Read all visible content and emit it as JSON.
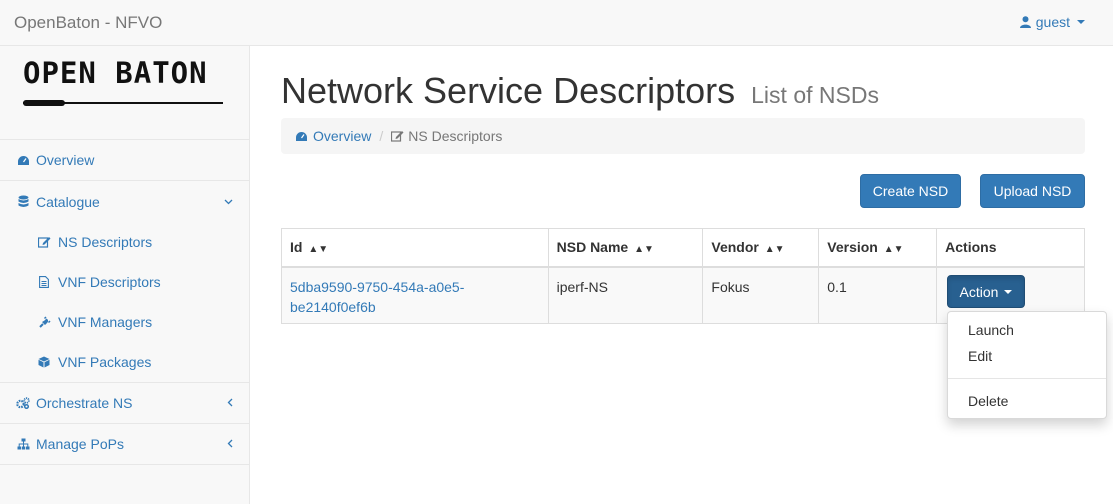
{
  "navbar": {
    "brand": "OpenBaton - NFVO",
    "user": "guest"
  },
  "sidebar": {
    "logo_text": "OPEN BATON",
    "items": [
      {
        "label": "Overview",
        "icon": "dashboard-icon"
      },
      {
        "label": "Catalogue",
        "icon": "database-icon",
        "expanded": true,
        "children": [
          {
            "label": "NS Descriptors",
            "icon": "edit-icon"
          },
          {
            "label": "VNF Descriptors",
            "icon": "file-text-icon"
          },
          {
            "label": "VNF Managers",
            "icon": "plug-icon"
          },
          {
            "label": "VNF Packages",
            "icon": "cube-icon"
          }
        ]
      },
      {
        "label": "Orchestrate NS",
        "icon": "cogs-icon"
      },
      {
        "label": "Manage PoPs",
        "icon": "sitemap-icon"
      }
    ]
  },
  "main": {
    "title": "Network Service Descriptors",
    "subtitle": "List of NSDs",
    "breadcrumb": {
      "home": "Overview",
      "current": "NS Descriptors"
    },
    "buttons": {
      "create": "Create NSD",
      "upload": "Upload NSD"
    },
    "table": {
      "headers": [
        "Id",
        "NSD Name",
        "Vendor",
        "Version",
        "Actions"
      ],
      "rows": [
        {
          "id": "5dba9590-9750-454a-a0e5-be2140f0ef6b",
          "id_line1": "5dba9590-9750-454a-a0e5-",
          "id_line2": "be2140f0ef6b",
          "name": "iperf-NS",
          "vendor": "Fokus",
          "version": "0.1",
          "action_label": "Action"
        }
      ]
    },
    "action_menu": {
      "items": [
        "Launch",
        "Edit",
        "Delete"
      ]
    }
  },
  "colors": {
    "link": "#337ab7",
    "primary_button": "#337ab7",
    "active_button": "#286090"
  }
}
